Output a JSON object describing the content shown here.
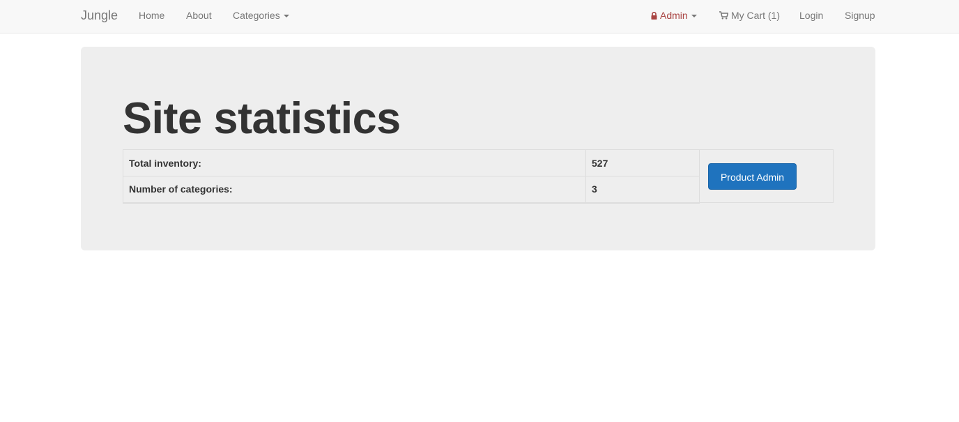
{
  "navbar": {
    "brand": "Jungle",
    "left_links": [
      {
        "label": "Home"
      },
      {
        "label": "About"
      },
      {
        "label": "Categories"
      }
    ],
    "admin": {
      "label": "Admin",
      "color": "#a94442"
    },
    "cart": {
      "label": "My Cart (1)"
    },
    "login": {
      "label": "Login"
    },
    "signup": {
      "label": "Signup"
    }
  },
  "main": {
    "title": "Site statistics",
    "stats": [
      {
        "label": "Total inventory:",
        "value": "527"
      },
      {
        "label": "Number of categories:",
        "value": "3"
      }
    ],
    "product_admin_button": "Product Admin"
  },
  "colors": {
    "navbar_bg": "#f8f8f8",
    "jumbotron_bg": "#eeeeee",
    "primary": "#1f73be",
    "admin_accent": "#a94442"
  },
  "icons": {
    "admin": "lock-icon",
    "cart": "shopping-cart-icon",
    "dropdown": "caret-down-icon"
  }
}
